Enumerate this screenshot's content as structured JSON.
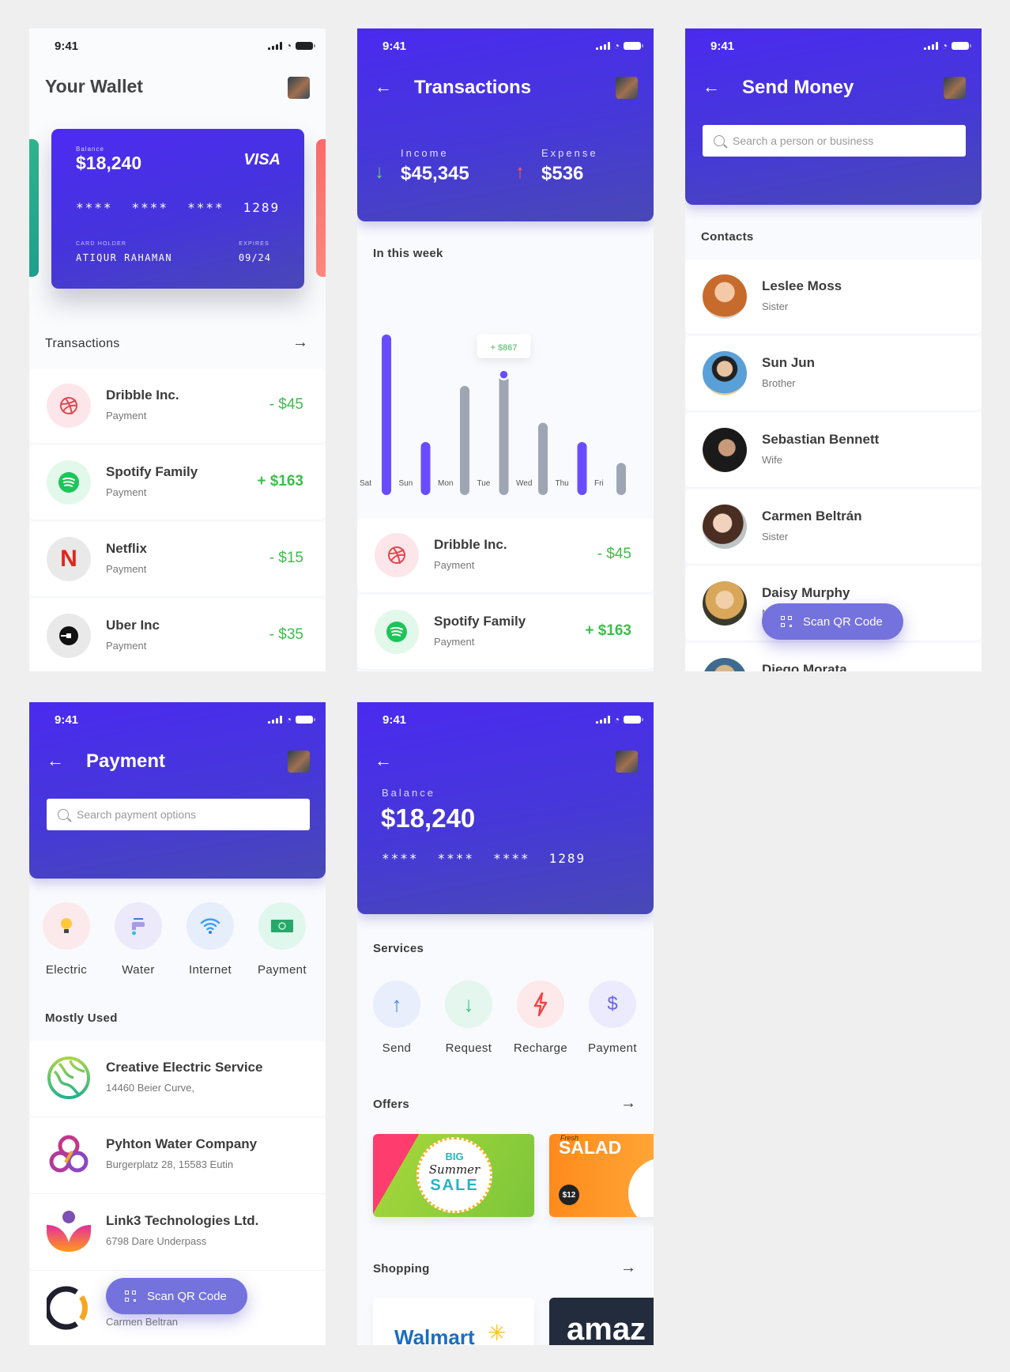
{
  "status_time": "9:41",
  "wallet": {
    "title": "Your Wallet",
    "card": {
      "balance_label": "Balance",
      "balance": "$18,240",
      "brand": "VISA",
      "number_groups": [
        "****",
        "****",
        "****",
        "1289"
      ],
      "holder_label": "CARD HOLDER",
      "holder": "ATIQUR RAHAMAN",
      "expires_label": "EXPIRES",
      "expires": "09/24"
    },
    "transactions_title": "Transactions",
    "transactions": [
      {
        "name": "Dribble Inc.",
        "type": "Payment",
        "amount": "- $45",
        "icon": "dribbble-icon"
      },
      {
        "name": "Spotify Family",
        "type": "Payment",
        "amount": "+ $163",
        "icon": "spotify-icon"
      },
      {
        "name": "Netflix",
        "type": "Payment",
        "amount": "- $15",
        "icon": "netflix-icon"
      },
      {
        "name": "Uber Inc",
        "type": "Payment",
        "amount": "- $35",
        "icon": "uber-icon"
      }
    ]
  },
  "transactions_screen": {
    "title": "Transactions",
    "income_label": "Income",
    "income": "$45,345",
    "expense_label": "Expense",
    "expense": "$536",
    "week_title": "In this week",
    "tooltip": "+ $867",
    "transactions": [
      {
        "name": "Dribble Inc.",
        "type": "Payment",
        "amount": "- $45"
      },
      {
        "name": "Spotify Family",
        "type": "Payment",
        "amount": "+ $163"
      }
    ]
  },
  "chart_data": {
    "type": "bar",
    "title": "In this week",
    "categories": [
      "Sat",
      "Sun",
      "Mon",
      "Tue",
      "Wed",
      "Thu",
      "Fri"
    ],
    "values": [
      100,
      33,
      68,
      75,
      45,
      33,
      20
    ],
    "highlight": [
      true,
      true,
      false,
      false,
      false,
      true,
      false
    ],
    "selected_index": 3,
    "selected_label": "+ $867",
    "ylim": [
      0,
      100
    ],
    "grid": false,
    "colors": {
      "highlight": "#6a4cff",
      "normal": "#9ea6b4"
    }
  },
  "send_money": {
    "title": "Send Money",
    "search_placeholder": "Search a person or business",
    "contacts_title": "Contacts",
    "contacts": [
      {
        "name": "Leslee Moss",
        "relation": "Sister"
      },
      {
        "name": "Sun Jun",
        "relation": "Brother"
      },
      {
        "name": "Sebastian Bennett",
        "relation": "Wife"
      },
      {
        "name": "Carmen Beltrán",
        "relation": "Sister"
      },
      {
        "name": "Daisy Murphy",
        "relation": "M"
      },
      {
        "name": "Diego Morata",
        "relation": ""
      }
    ],
    "scan_label": "Scan QR Code"
  },
  "payment": {
    "title": "Payment",
    "search_placeholder": "Search payment options",
    "categories": [
      {
        "label": "Electric",
        "icon": "lightbulb-icon"
      },
      {
        "label": "Water",
        "icon": "faucet-icon"
      },
      {
        "label": "Internet",
        "icon": "wifi-icon"
      },
      {
        "label": "Payment",
        "icon": "banknote-icon"
      }
    ],
    "mostly_used_title": "Mostly Used",
    "providers": [
      {
        "name": "Creative Electric Service",
        "address": "14460 Beier Curve,"
      },
      {
        "name": "Pyhton Water Company",
        "address": "Burgerplatz 28, 15583 Eutin"
      },
      {
        "name": "Link3 Technologies Ltd.",
        "address": "6798 Dare Underpass"
      },
      {
        "name": "",
        "address": "Carmen Beltran"
      }
    ],
    "scan_label": "Scan QR Code"
  },
  "home": {
    "balance_label": "Balance",
    "balance": "$18,240",
    "number_groups": [
      "****",
      "****",
      "****",
      "1289"
    ],
    "services_title": "Services",
    "services": [
      {
        "label": "Send",
        "icon": "arrow-up-icon"
      },
      {
        "label": "Request",
        "icon": "arrow-down-icon"
      },
      {
        "label": "Recharge",
        "icon": "lightning-icon"
      },
      {
        "label": "Payment",
        "icon": "dollar-icon"
      }
    ],
    "offers_title": "Offers",
    "offers": [
      {
        "line1": "BIG",
        "line2": "Summer",
        "line3": "SALE"
      },
      {
        "line1": "Fresh",
        "line2": "SALAD",
        "price": "$12"
      }
    ],
    "shopping_title": "Shopping",
    "shops": [
      "Walmart",
      "amaz"
    ]
  }
}
